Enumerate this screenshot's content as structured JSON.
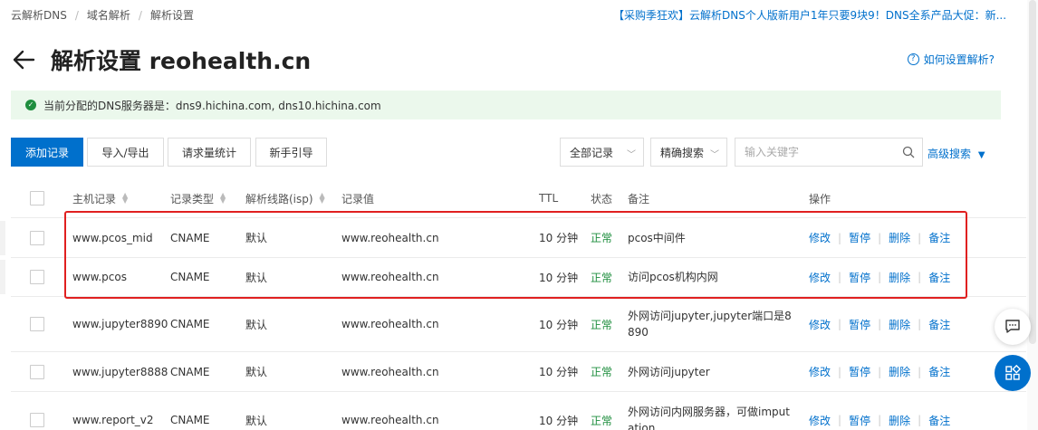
{
  "breadcrumb": [
    "云解析DNS",
    "域名解析",
    "解析设置"
  ],
  "promo": "【采购季狂欢】云解析DNS个人版新用户1年只要9块9！DNS全系产品大促：新...",
  "page_title": "解析设置 reohealth.cn",
  "help_link": "如何设置解析?",
  "notice": "当前分配的DNS服务器是：dns9.hichina.com, dns10.hichina.com",
  "toolbar": {
    "add": "添加记录",
    "import_export": "导入/导出",
    "stats": "请求量统计",
    "guide": "新手引导",
    "filter_all": "全部记录",
    "precise_search": "精确搜索",
    "search_placeholder": "输入关键字",
    "advanced_search": "高级搜索"
  },
  "columns": {
    "host": "主机记录",
    "type": "记录类型",
    "line": "解析线路(isp)",
    "value": "记录值",
    "ttl": "TTL",
    "status": "状态",
    "note": "备注",
    "actions": "操作"
  },
  "actions": [
    "修改",
    "暂停",
    "删除",
    "备注"
  ],
  "rows": [
    {
      "host": "www.pcos_mid",
      "type": "CNAME",
      "line": "默认",
      "value": "www.reohealth.cn",
      "ttl": "10 分钟",
      "status": "正常",
      "note": "pcos中间件"
    },
    {
      "host": "www.pcos",
      "type": "CNAME",
      "line": "默认",
      "value": "www.reohealth.cn",
      "ttl": "10 分钟",
      "status": "正常",
      "note": "访问pcos机构内网"
    },
    {
      "host": "www.jupyter8890",
      "type": "CNAME",
      "line": "默认",
      "value": "www.reohealth.cn",
      "ttl": "10 分钟",
      "status": "正常",
      "note": "外网访问jupyter,jupyter端口是8890"
    },
    {
      "host": "www.jupyter8888",
      "type": "CNAME",
      "line": "默认",
      "value": "www.reohealth.cn",
      "ttl": "10 分钟",
      "status": "正常",
      "note": "外网访问jupyter"
    },
    {
      "host": "www.report_v2",
      "type": "CNAME",
      "line": "默认",
      "value": "www.reohealth.cn",
      "ttl": "10 分钟",
      "status": "正常",
      "note": "外网访问内网服务器，可做imputation"
    }
  ],
  "colors": {
    "accent": "#0070cc",
    "ok": "#1e8e3e",
    "highlight": "#e02020",
    "notice_bg": "#ebf8ec"
  }
}
